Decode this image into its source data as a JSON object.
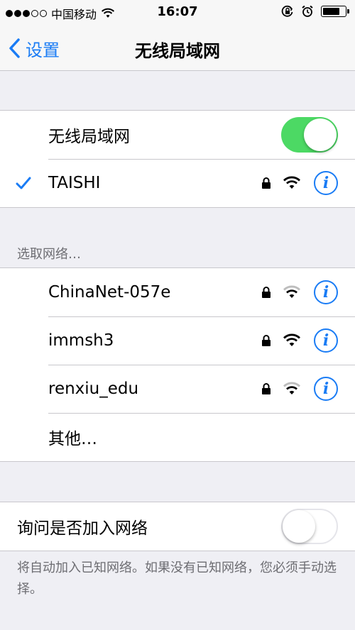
{
  "status_bar": {
    "carrier": "中国移动",
    "time": "16:07",
    "signal_bars": 3,
    "battery_level": 0.75
  },
  "nav": {
    "back_label": "设置",
    "title": "无线局域网"
  },
  "wifi_toggle": {
    "label": "无线局域网",
    "on": true
  },
  "connected_network": {
    "name": "TAISHI",
    "secured": true
  },
  "section": {
    "choose_network_label": "选取网络…"
  },
  "networks": [
    {
      "name": "ChinaNet-057e",
      "secured": true
    },
    {
      "name": "immsh3",
      "secured": true
    },
    {
      "name": "renxiu_edu",
      "secured": true
    }
  ],
  "other_label": "其他…",
  "ask_to_join": {
    "label": "询问是否加入网络",
    "on": false
  },
  "footer_note": "将自动加入已知网络。如果没有已知网络，您必须手动选择。",
  "colors": {
    "accent": "#1a7cf5",
    "toggle_on": "#4cd964",
    "background": "#efeff4"
  }
}
